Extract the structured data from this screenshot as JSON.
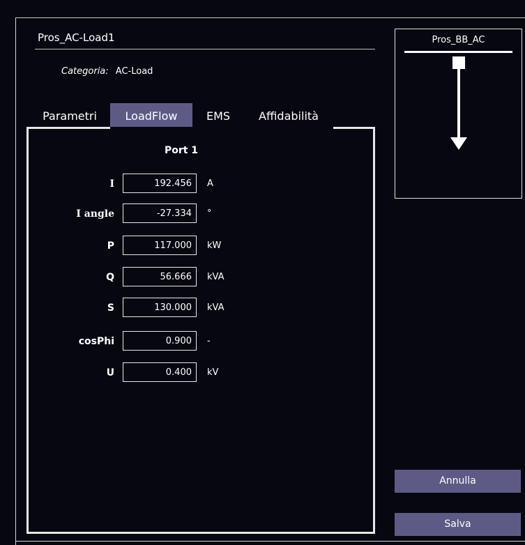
{
  "header": {
    "title": "Pros_AC-Load1",
    "category_label": "Categoria:",
    "category_value": "AC-Load"
  },
  "tabs": [
    {
      "label": "Parametri",
      "active": false
    },
    {
      "label": "LoadFlow",
      "active": true
    },
    {
      "label": "EMS",
      "active": false
    },
    {
      "label": "Affidabilità",
      "active": false
    }
  ],
  "loadflow": {
    "port_title": "Port 1",
    "rows": [
      {
        "label": "I",
        "value": "192.456",
        "unit": "A"
      },
      {
        "label": "I angle",
        "value": "-27.334",
        "unit": "°"
      },
      {
        "label": "P",
        "value": "117.000",
        "unit": "kW"
      },
      {
        "label": "Q",
        "value": "56.666",
        "unit": "kVA"
      },
      {
        "label": "S",
        "value": "130.000",
        "unit": "kVA"
      },
      {
        "label": "cosPhi",
        "value": "0.900",
        "unit": "-"
      },
      {
        "label": "U",
        "value": "0.400",
        "unit": "kV"
      }
    ]
  },
  "diagram": {
    "bus_name": "Pros_BB_AC"
  },
  "buttons": {
    "cancel": "Annulla",
    "save": "Salva"
  },
  "colors": {
    "background": "#070711",
    "accent": "#5d5b86",
    "text": "#ffffff"
  }
}
